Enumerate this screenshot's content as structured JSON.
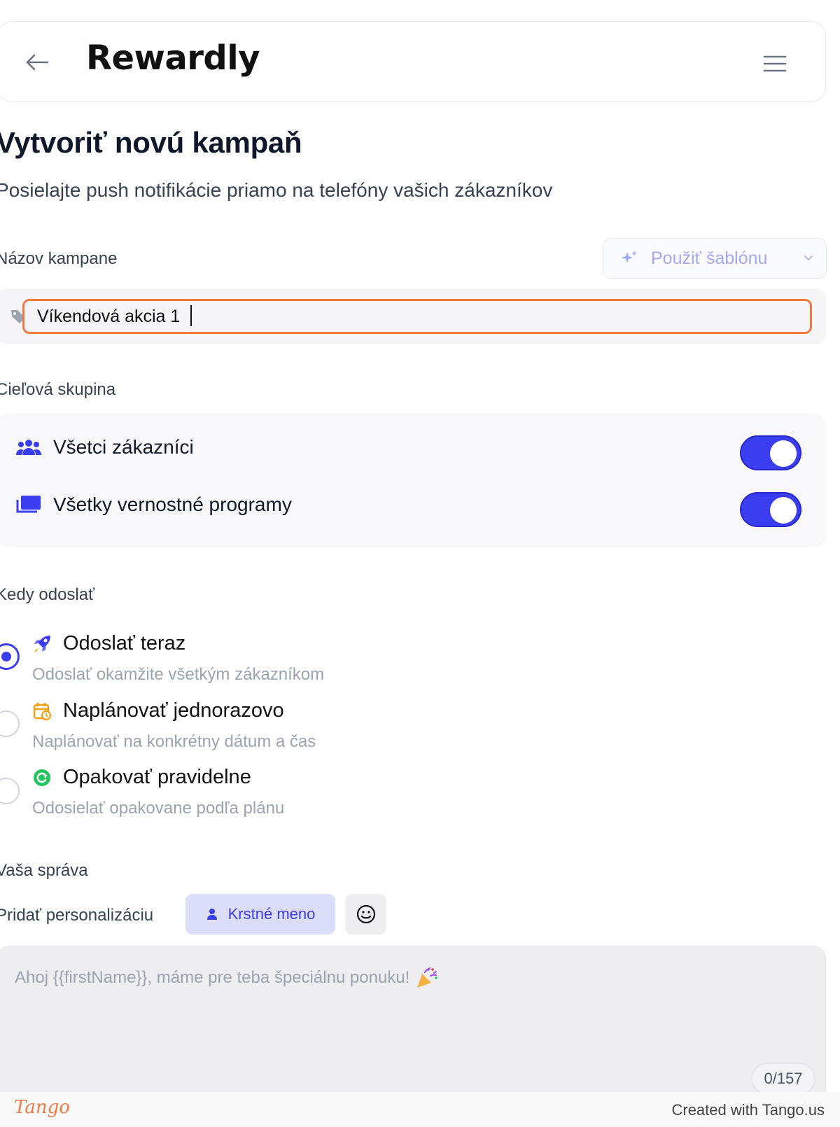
{
  "header": {
    "logo_text": "Rewardly",
    "back_icon": "arrow-left-icon",
    "menu_icon": "hamburger-menu-icon"
  },
  "page": {
    "title": "Vytvoriť novú kampaň",
    "subtitle": "Posielajte push notifikácie priamo na telefóny vašich zákazníkov"
  },
  "campaign_name": {
    "label": "Názov kampane",
    "value": "Víkendová akcia 1",
    "template_button": "Použiť šablónu"
  },
  "target_group": {
    "label": "Cieľová skupina",
    "options": [
      {
        "label": "Všetci zákazníci",
        "enabled": true,
        "icon": "users-icon"
      },
      {
        "label": "Všetky vernostné programy",
        "enabled": true,
        "icon": "cards-icon"
      }
    ]
  },
  "send_time": {
    "label": "Kedy odoslať",
    "options": [
      {
        "title": "Odoslať teraz",
        "description": "Odoslať okamžite všetkým zákazníkom",
        "selected": true,
        "icon": "rocket-icon"
      },
      {
        "title": "Naplánovať jednorazovo",
        "description": "Naplánovať na konkrétny dátum a čas",
        "selected": false,
        "icon": "calendar-clock-icon"
      },
      {
        "title": "Opakovať pravidelne",
        "description": "Odosielať opakovane podľa plánu",
        "selected": false,
        "icon": "repeat-icon"
      }
    ]
  },
  "message": {
    "label": "Vaša správa",
    "personalization_label": "Pridať personalizáciu",
    "first_name_chip": "Krstné meno",
    "placeholder": "Ahoj {{firstName}}, máme pre teba špeciálnu ponuku!",
    "counter": "0/157"
  },
  "footer": {
    "brand": "Tango",
    "created_with": "Created with Tango.us"
  },
  "colors": {
    "accent": "#3b3ef0",
    "focus_outline": "#f07a45",
    "muted_text": "#9ca3af"
  }
}
